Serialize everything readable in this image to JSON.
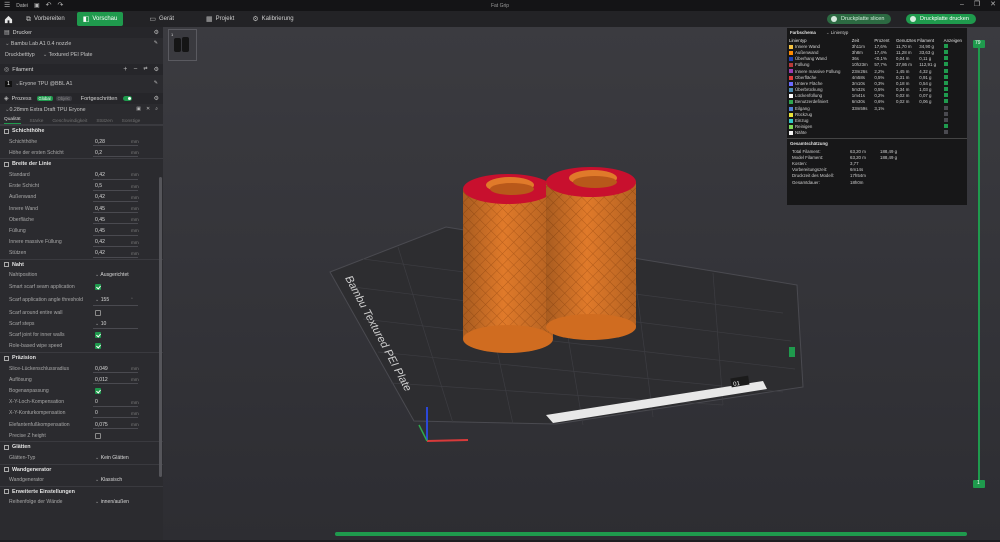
{
  "app": {
    "title": "Fat Grip",
    "file_menu": "Datei"
  },
  "toolbar": {
    "tabs": [
      {
        "label": "Vorbereiten",
        "icon": "prepare-icon"
      },
      {
        "label": "Vorschau",
        "icon": "preview-icon",
        "active": true
      },
      {
        "label": "Gerät",
        "icon": "device-icon"
      },
      {
        "label": "Projekt",
        "icon": "project-icon"
      },
      {
        "label": "Kalibrierung",
        "icon": "calibration-icon"
      }
    ],
    "slice_button": "Druckplatte slicen",
    "print_button": "Druckplatte drucken",
    "accent": "#1f9a4d"
  },
  "sidebar": {
    "printer_header": "Drucker",
    "printer_name": "Bambu Lab A1 0.4 nozzle",
    "plate_label": "Druckbetttyp",
    "plate_value": "Textured PEI Plate",
    "filament_header": "Filament",
    "filament_index": "1",
    "filament_name": "Eryone TPU @BBL A1",
    "process_header": "Prozess",
    "process_global": "Global",
    "process_object": "Objekt",
    "advanced_label": "Fortgeschritten",
    "process_profile": "0.28mm Extra Draft TPU Eryone",
    "quality_tabs": [
      "Qualität",
      "Stärke",
      "Geschwindigkeit",
      "Stützen",
      "Sonstige"
    ],
    "groups": {
      "layer_height": "Schichthöhe",
      "line_width": "Breite der Linie",
      "seam": "Naht",
      "precision": "Präzision",
      "ironing": "Glätten",
      "wall_generator": "Wandgenerator",
      "advanced": "Erweiterte Einstellungen"
    },
    "layer_params": [
      {
        "label": "Schichthöhe",
        "value": "0,28",
        "unit": "mm"
      },
      {
        "label": "Höhe der ersten Schicht",
        "value": "0,2",
        "unit": "mm"
      }
    ],
    "width_params": [
      {
        "label": "Standard",
        "value": "0,42",
        "unit": "mm"
      },
      {
        "label": "Erste Schicht",
        "value": "0,5",
        "unit": "mm"
      },
      {
        "label": "Außenwand",
        "value": "0,42",
        "unit": "mm"
      },
      {
        "label": "Innere Wand",
        "value": "0,45",
        "unit": "mm"
      },
      {
        "label": "Oberfläche",
        "value": "0,45",
        "unit": "mm"
      },
      {
        "label": "Füllung",
        "value": "0,45",
        "unit": "mm"
      },
      {
        "label": "Innere massive Füllung",
        "value": "0,42",
        "unit": "mm"
      },
      {
        "label": "Stützen",
        "value": "0,42",
        "unit": "mm"
      }
    ],
    "seam_position_label": "Nahtposition",
    "seam_position_value": "Ausgerichtet",
    "smart_scarf_label": "Smart scarf seam application",
    "scarf_threshold_label": "Scarf application angle threshold",
    "scarf_threshold_value": "155",
    "scarf_threshold_unit": "°",
    "scarf_entire_label": "Scarf around entire wall",
    "scarf_steps_label": "Scarf steps",
    "scarf_steps_value": "10",
    "scarf_inner_label": "Scarf joint for inner walls",
    "role_wipe_label": "Role-based wipe speed",
    "precision_params": [
      {
        "label": "Slice-Lückenschlussradius",
        "value": "0,049",
        "unit": "mm"
      },
      {
        "label": "Auflösung",
        "value": "0,012",
        "unit": "mm"
      }
    ],
    "arc_fitting_label": "Bogenanpassung",
    "xy_params": [
      {
        "label": "X-Y-Loch-Kompensation",
        "value": "0",
        "unit": "mm"
      },
      {
        "label": "X-Y-Konturkompensation",
        "value": "0",
        "unit": "mm"
      },
      {
        "label": "Elefantenfußkompensation",
        "value": "0,075",
        "unit": "mm"
      }
    ],
    "precise_z_label": "Precise Z height",
    "ironing_type_label": "Glätten-Typ",
    "ironing_type_value": "Kein Glätten",
    "wall_generator_label": "Wandgenerator",
    "wall_generator_value": "Klassisch",
    "wall_order_label": "Reihenfolge der Wände",
    "wall_order_value": "innen/außen"
  },
  "legend": {
    "scheme_label": "Farbschema",
    "scheme_value": "Linientyp",
    "headers": [
      "Linientyp",
      "Zeit",
      "Prozent",
      "Genutztes Filament",
      "Anzeigen"
    ],
    "rows": [
      {
        "name": "Innere Wand",
        "time": "3h11m",
        "pct": "17,6%",
        "len": "11,70 m",
        "weight": "34,90 g",
        "color": "#f5c342",
        "show": true
      },
      {
        "name": "Außenwand",
        "time": "3h8m",
        "pct": "17,4%",
        "len": "11,28 m",
        "weight": "33,63 g",
        "color": "#ff8a00",
        "show": true
      },
      {
        "name": "Überhang Wand",
        "time": "36s",
        "pct": "<0,1%",
        "len": "0,04 m",
        "weight": "0,11 g",
        "color": "#1d3fb5",
        "show": true
      },
      {
        "name": "Füllung",
        "time": "10h23m",
        "pct": "57,7%",
        "len": "37,86 m",
        "weight": "112,91 g",
        "color": "#b83a3a",
        "show": true
      },
      {
        "name": "Innere massive Füllung",
        "time": "23m26s",
        "pct": "2,2%",
        "len": "1,45 m",
        "weight": "4,32 g",
        "color": "#9a3cb5",
        "show": true
      },
      {
        "name": "Oberfläche",
        "time": "4m58s",
        "pct": "0,5%",
        "len": "0,31 m",
        "weight": "0,91 g",
        "color": "#e33b3b",
        "show": true
      },
      {
        "name": "Untere Fläche",
        "time": "3m10s",
        "pct": "0,3%",
        "len": "0,18 m",
        "weight": "0,54 g",
        "color": "#6a6aff",
        "show": true
      },
      {
        "name": "Überbrückung",
        "time": "5m32s",
        "pct": "0,5%",
        "len": "0,34 m",
        "weight": "1,03 g",
        "color": "#4d8fb5",
        "show": true
      },
      {
        "name": "Lückenfüllung",
        "time": "1m41s",
        "pct": "0,2%",
        "len": "0,02 m",
        "weight": "0,07 g",
        "color": "#ffffff",
        "show": true
      },
      {
        "name": "Benutzerdefiniert",
        "time": "6m30s",
        "pct": "0,6%",
        "len": "0,02 m",
        "weight": "0,06 g",
        "color": "#2fa84f",
        "show": true
      },
      {
        "name": "Eilgang",
        "time": "33m59s",
        "pct": "3,1%",
        "len": "",
        "weight": "",
        "color": "#4f7fd6",
        "show": false
      },
      {
        "name": "Rückzug",
        "time": "",
        "pct": "",
        "len": "",
        "weight": "",
        "color": "#e8e23a",
        "show": false
      },
      {
        "name": "Einzug",
        "time": "",
        "pct": "",
        "len": "",
        "weight": "",
        "color": "#30c8c8",
        "show": false
      },
      {
        "name": "Reinigen",
        "time": "",
        "pct": "",
        "len": "",
        "weight": "",
        "color": "#7ed957",
        "show": true
      },
      {
        "name": "Nähte",
        "time": "",
        "pct": "",
        "len": "",
        "weight": "",
        "color": "#f2f2f2",
        "show": false
      }
    ],
    "estimate_title": "Gesamtschätzung",
    "estimates": [
      {
        "label": "Total Filament:",
        "v1": "63,20 m",
        "v2": "188,49 g"
      },
      {
        "label": "Model Filament:",
        "v1": "63,20 m",
        "v2": "188,49 g"
      },
      {
        "label": "Kosten:",
        "v1": "3,77",
        "v2": ""
      },
      {
        "label": "Vorbereitungszeit:",
        "v1": "6m14s",
        "v2": ""
      },
      {
        "label": "Druckzeit des Modell:",
        "v1": "17h54m",
        "v2": ""
      },
      {
        "label": "Gesamtdauer:",
        "v1": "18h0m",
        "v2": ""
      }
    ]
  },
  "viewport": {
    "plate_text": "Bambu Textured PEI Plate",
    "plate_label_tag": "01",
    "layer_top": "79",
    "layer_bottom": "1",
    "plate_color": "#2d2d30",
    "model_color": "#e07a2a",
    "top_color": "#c8102e"
  }
}
